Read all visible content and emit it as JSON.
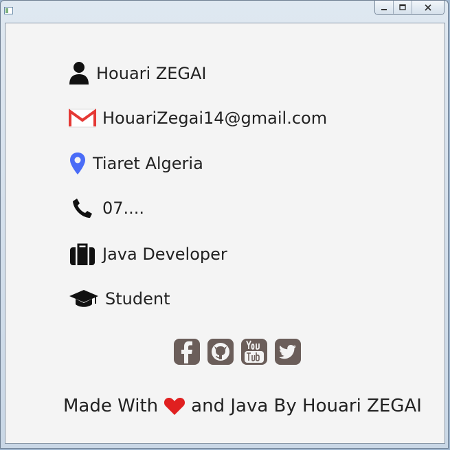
{
  "profile": {
    "name": "Houari ZEGAI",
    "email": "HouariZegai14@gmail.com",
    "location": "Tiaret Algeria",
    "phone": "07....",
    "job": "Java Developer",
    "status": "Student"
  },
  "social": [
    {
      "name": "facebook-icon"
    },
    {
      "name": "github-icon"
    },
    {
      "name": "youtube-icon"
    },
    {
      "name": "twitter-icon"
    }
  ],
  "footer": {
    "before": "Made With",
    "after": "and Java By Houari ZEGAI"
  },
  "colors": {
    "text": "#222222",
    "email_icon": "#e53935",
    "location_icon": "#4a6cf7",
    "social_icon": "#6b5e5a",
    "heart": "#e02020"
  }
}
